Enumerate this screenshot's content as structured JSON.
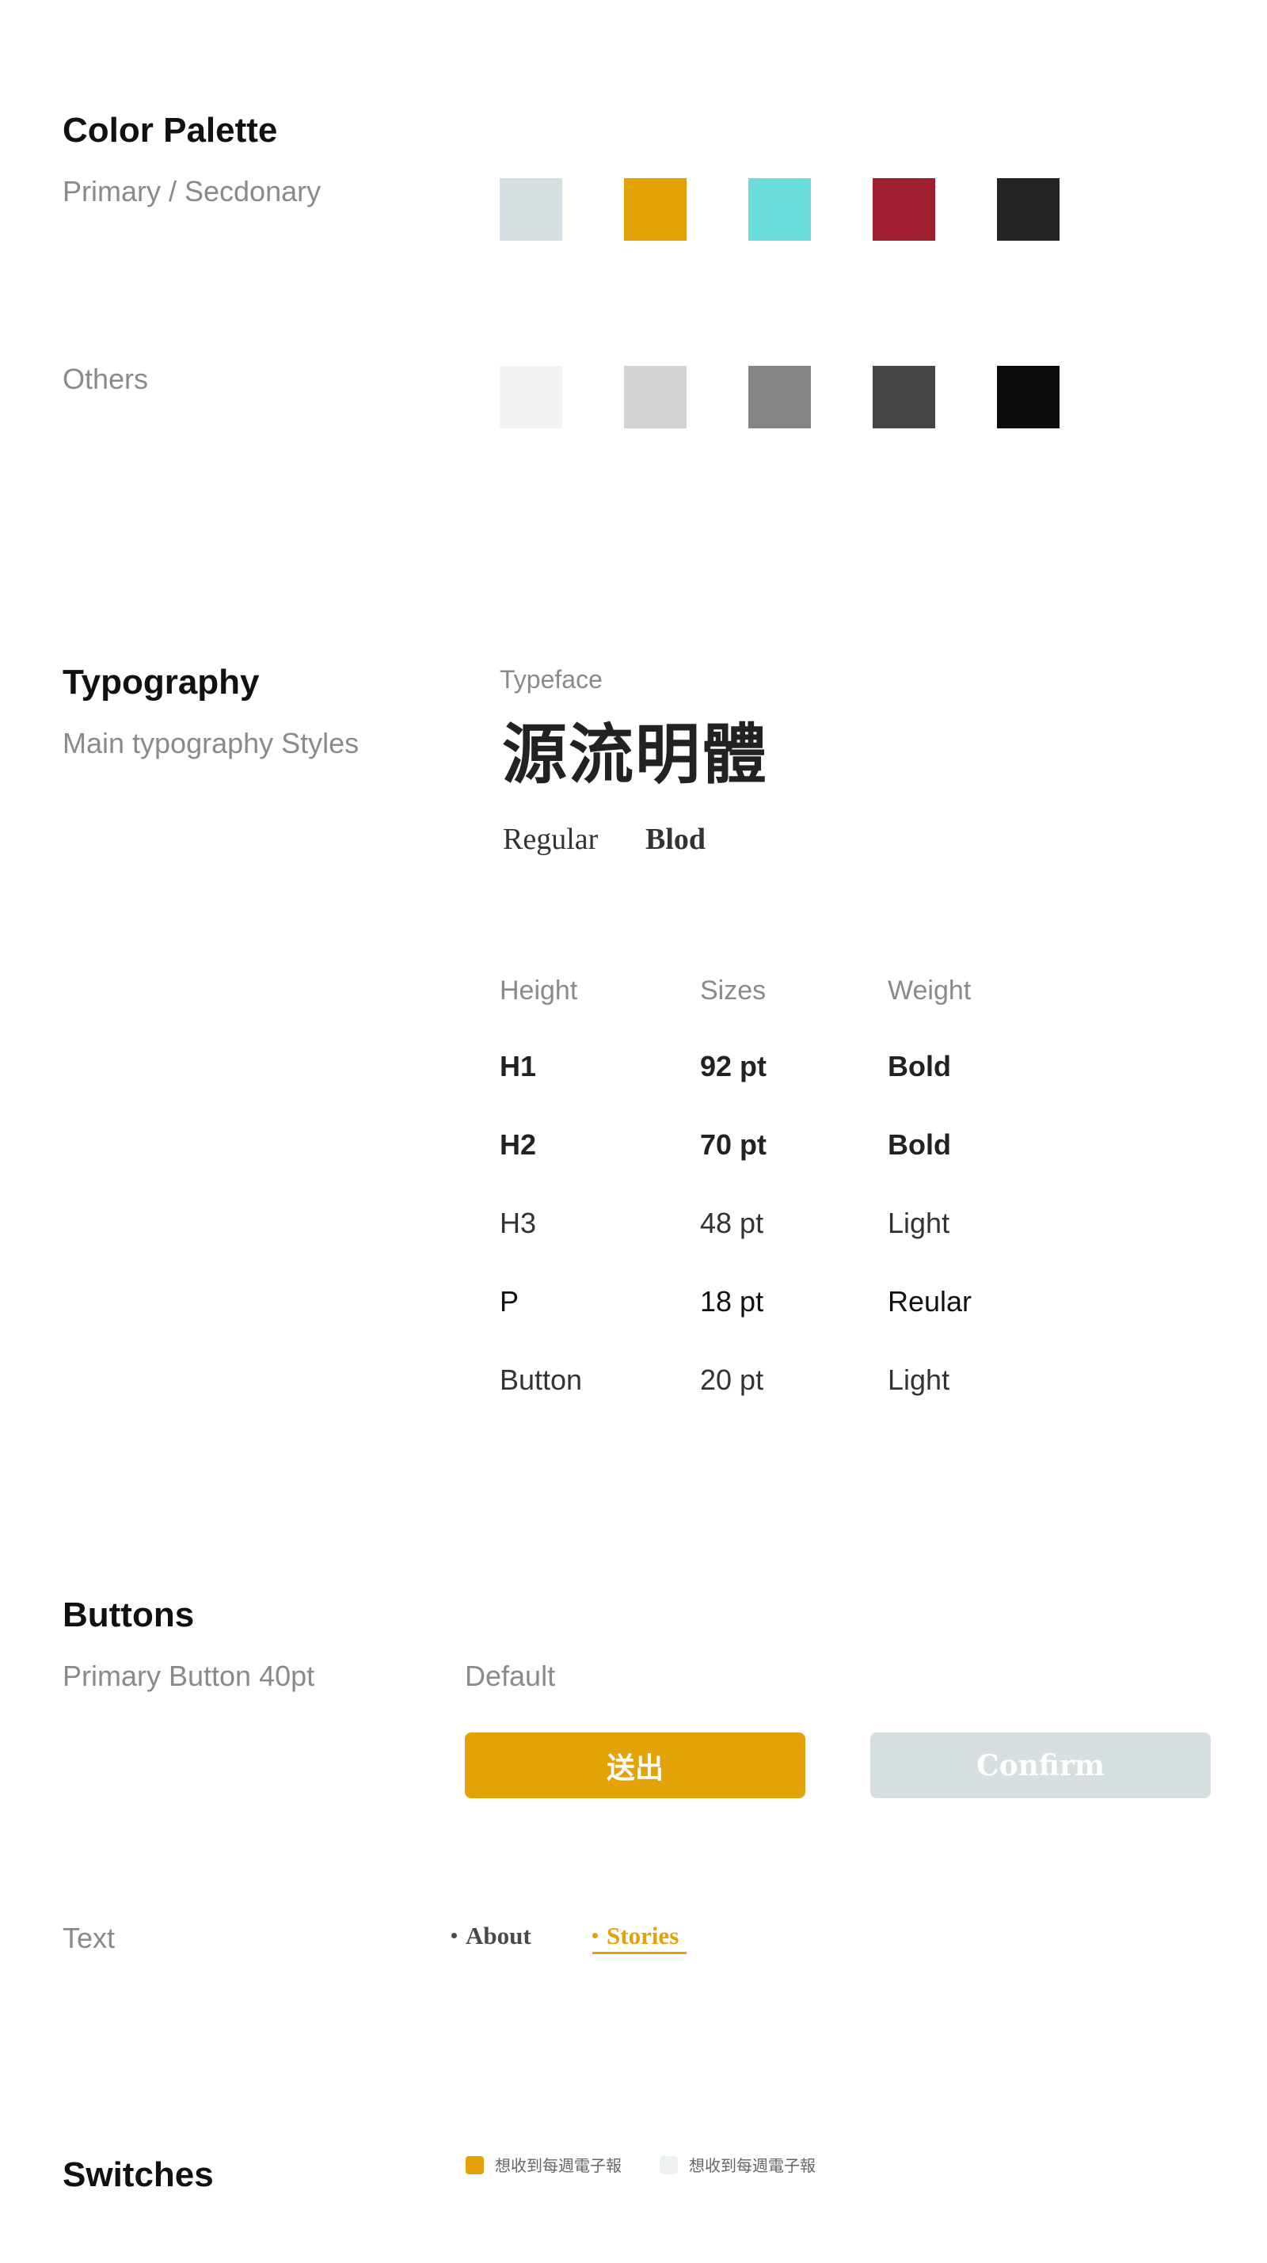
{
  "color_palette": {
    "title": "Color Palette",
    "primary_label": "Primary / Secdonary",
    "primary_colors": [
      "#d5dfe1",
      "#e3a205",
      "#6adcdb",
      "#9f1e30",
      "#242424"
    ],
    "others_label": "Others",
    "other_colors": [
      "#f3f3f3",
      "#d3d3d3",
      "#848484",
      "#454545",
      "#0b0b0b"
    ]
  },
  "typography": {
    "title": "Typography",
    "subtitle": "Main typography Styles",
    "typeface_label": "Typeface",
    "typeface_name": "源流明體",
    "weights": {
      "regular": "Regular",
      "bold": "Blod"
    },
    "table": {
      "headers": {
        "height": "Height",
        "sizes": "Sizes",
        "weight": "Weight"
      },
      "rows": [
        {
          "height": "H1",
          "size": "92 pt",
          "weight": "Bold"
        },
        {
          "height": "H2",
          "size": "70 pt",
          "weight": "Bold"
        },
        {
          "height": "H3",
          "size": "48 pt",
          "weight": "Light"
        },
        {
          "height": "P",
          "size": "18 pt",
          "weight": "Reular"
        },
        {
          "height": "Button",
          "size": "20 pt",
          "weight": "Light"
        }
      ]
    }
  },
  "buttons": {
    "title": "Buttons",
    "subtitle": "Primary Button 40pt",
    "state_label": "Default",
    "primary_label": "送出",
    "disabled_label": "Confirm",
    "colors": {
      "primary": "#e3a205",
      "disabled": "#d7dfe0"
    }
  },
  "text_links": {
    "label": "Text",
    "about": "About",
    "stories": "Stories",
    "colors": {
      "inactive": "#4a4a4a",
      "active": "#e3a205"
    }
  },
  "switches": {
    "title": "Switches",
    "on_label": "想收到每週電子報",
    "off_label": "想收到每週電子報",
    "colors": {
      "on": "#e3a205",
      "off": "#eef3f2"
    }
  }
}
